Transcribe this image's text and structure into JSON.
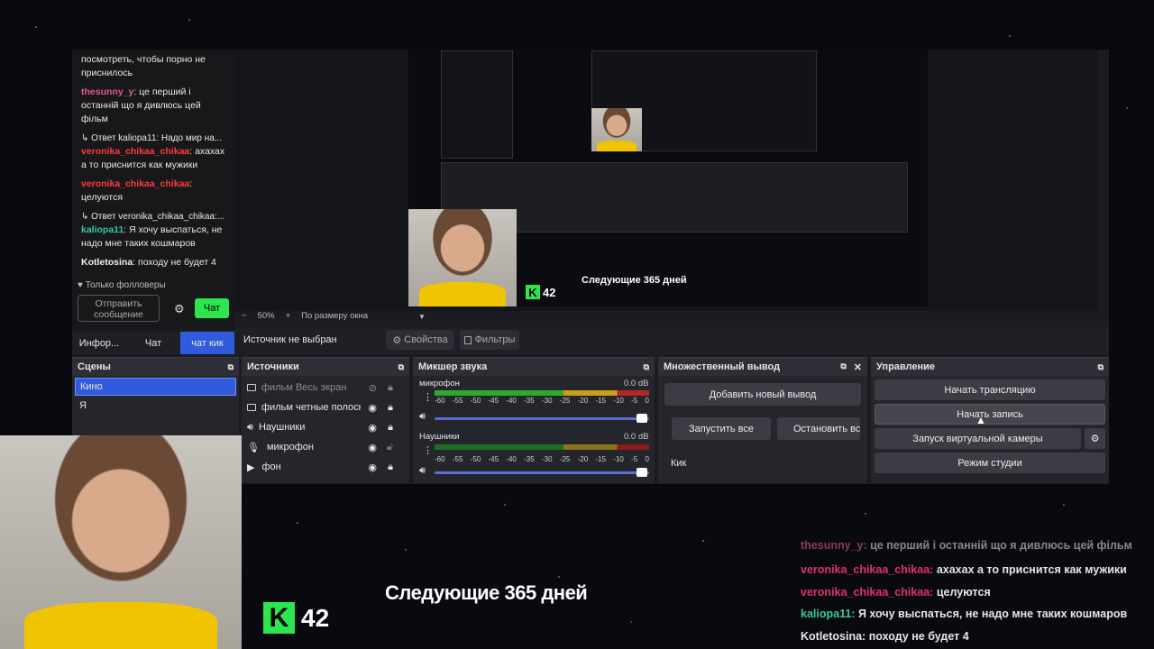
{
  "chat": {
    "messages": [
      {
        "user": "",
        "text": "посмотреть, чтобы порно не приснилось"
      },
      {
        "user": "thesunny_y",
        "text": "це перший і останній що я дивлюсь цей фільм"
      },
      {
        "reply": "↳ Ответ kaliopa11: Надо мир на..."
      },
      {
        "user": "veronika_chikaa_chikaa",
        "text": "ахахах а то приснится как мужики"
      },
      {
        "user": "veronika_chikaa_chikaa",
        "text": "целуются"
      },
      {
        "reply": "↳ Ответ veronika_chikaa_chikaa:..."
      },
      {
        "user": "kaliopa11",
        "text": "Я хочу выспаться, не надо мне таких кошмаров"
      },
      {
        "user": "Kotletosina",
        "text": "походу не будет 4"
      }
    ],
    "followers_only": "♥ Только фолловеры",
    "send_placeholder": "Отправить сообщение",
    "chat_button": "Чат",
    "tabs": [
      "Инфор...",
      "Чат",
      "чат кик"
    ]
  },
  "preview": {
    "zoom": "50%",
    "fit": "По размеру окна",
    "minus": "−",
    "plus": "+",
    "caption": "Следующие 365 дней",
    "counter": "42"
  },
  "toolbar": {
    "no_source": "Источник не выбран",
    "properties": "Свойства",
    "filters": "Фильтры"
  },
  "scenes": {
    "title": "Сцены",
    "items": [
      "Кино",
      "Я"
    ]
  },
  "sources": {
    "title": "Источники",
    "items": [
      {
        "name": "фильм Весь экран",
        "icon": "monitor-icon"
      },
      {
        "name": "фильм четные полоски",
        "icon": "monitor-icon"
      },
      {
        "name": "Наушники",
        "icon": "speaker-icon"
      },
      {
        "name": "микрофон",
        "icon": "mic-icon"
      },
      {
        "name": "фон",
        "icon": "play-icon"
      }
    ]
  },
  "mixer": {
    "title": "Микшер звука",
    "channels": [
      {
        "name": "микрофон",
        "db": "0.0 dB",
        "level": 0.6
      },
      {
        "name": "Наушники",
        "db": "0.0 dB",
        "level": 0.7
      }
    ],
    "scale": [
      "-60",
      "-55",
      "-50",
      "-45",
      "-40",
      "-35",
      "-30",
      "-25",
      "-20",
      "-15",
      "-10",
      "-5",
      "0"
    ]
  },
  "multi": {
    "title": "Множественный вывод",
    "add": "Добавить новый вывод",
    "start_all": "Запустить все",
    "stop_all": "Остановить все",
    "kick": "Кик"
  },
  "controls": {
    "title": "Управление",
    "stream": "Начать трансляцию",
    "record": "Начать запись",
    "virtual_cam": "Запуск виртуальной камеры",
    "studio": "Режим студии"
  },
  "overlay": {
    "caption": "Следующие 365 дней",
    "counter": "42",
    "chat": [
      {
        "user": "thesunny_y:",
        "text": "це перший і останній що я дивлюсь цей фільм"
      },
      {
        "user": "veronika_chikaa_chikaa:",
        "text": "ахахах а то приснится как мужики"
      },
      {
        "user": "veronika_chikaa_chikaa:",
        "text": "целуются"
      },
      {
        "user": "kaliopa11:",
        "text": "Я хочу выспаться, не надо мне таких кошмаров"
      },
      {
        "user": "Kotletosina:",
        "text": "походу не будет 4"
      }
    ]
  },
  "colors": {
    "accent": "#2f5bdc",
    "kick_green": "#2ce54f",
    "panel": "#25262c"
  }
}
